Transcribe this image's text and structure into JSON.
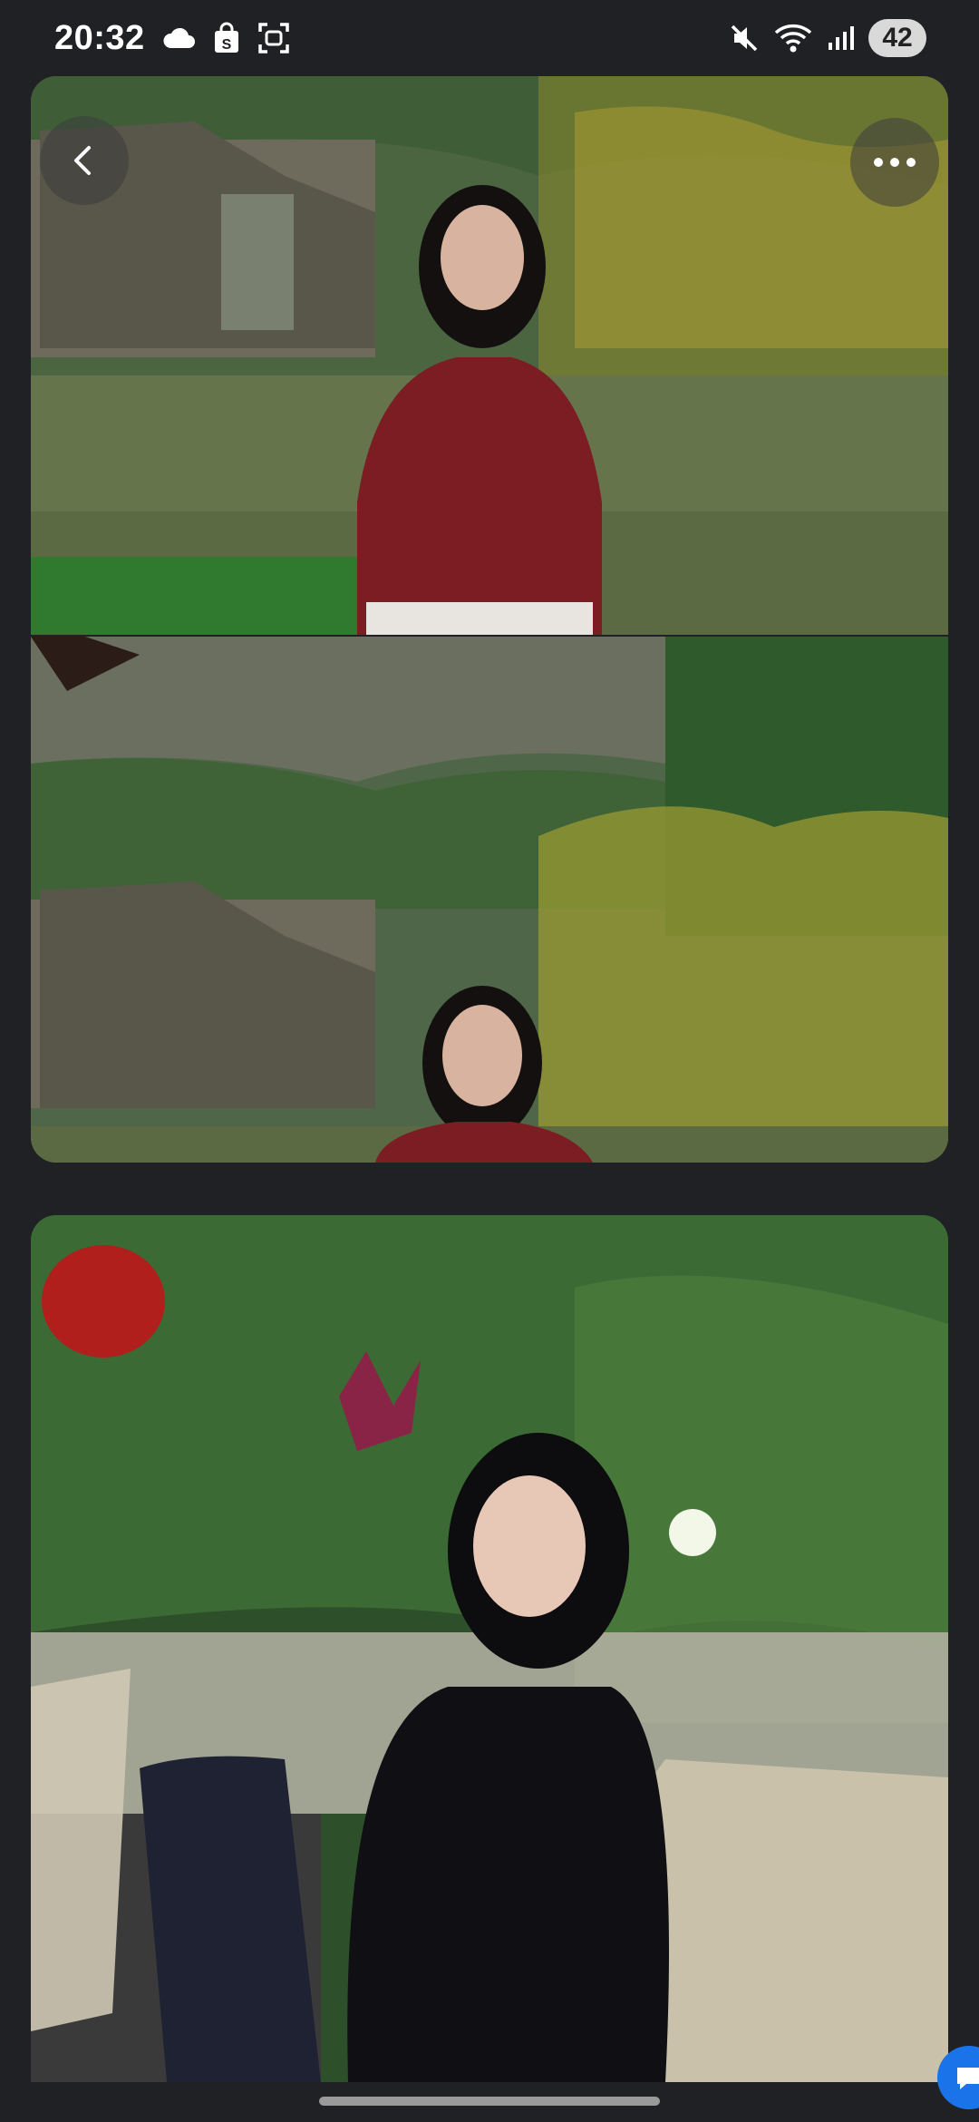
{
  "status_bar": {
    "time": "20:32",
    "left_icons": [
      "cloud-icon",
      "shopping-bag-icon",
      "screen-capture-icon"
    ],
    "right_icons": [
      "mute-icon",
      "wifi-icon",
      "signal-icon"
    ],
    "battery": "42"
  },
  "viewer": {
    "back_button": "back-icon",
    "more_button": "more-icon",
    "photos": [
      {
        "name": "photo-lake-closeup"
      },
      {
        "name": "photo-lake-wide"
      },
      {
        "name": "photo-garden-table"
      }
    ]
  },
  "colors": {
    "background": "#202124",
    "accent": "#1a73e8"
  }
}
